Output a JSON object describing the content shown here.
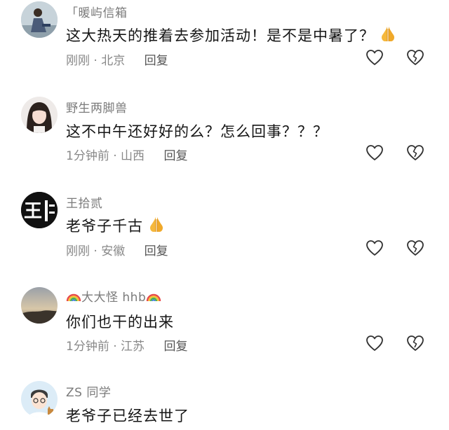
{
  "comments": [
    {
      "username": "「暖屿信箱",
      "text": "这大热天的推着去参加活动！是不是中暑了？",
      "time": "刚刚",
      "location": "北京",
      "reply_label": "回复",
      "has_pray_emoji": true
    },
    {
      "username": "野生两脚兽",
      "text": "这不中午还好好的么？怎么回事？？？",
      "time": "1分钟前",
      "location": "山西",
      "reply_label": "回复",
      "has_pray_emoji": false
    },
    {
      "username": "王拾贰",
      "text": "老爷子千古",
      "time": "刚刚",
      "location": "安徽",
      "reply_label": "回复",
      "has_pray_emoji": true,
      "avatar_text": "王"
    },
    {
      "username": "大大怪 hhb",
      "text": "你们也干的出来",
      "time": "1分钟前",
      "location": "江苏",
      "reply_label": "回复",
      "has_pray_emoji": false
    },
    {
      "username": "ZS 同学",
      "text": "老爷子已经去世了",
      "time": "",
      "location": "",
      "reply_label": "",
      "has_pray_emoji": false
    }
  ],
  "separator": "·",
  "icons": {
    "like": "heart-outline-icon",
    "dislike": "broken-heart-icon",
    "pray": "folded-hands-emoji",
    "rainbow": "rainbow-emoji"
  },
  "colors": {
    "username": "#7b7b7b",
    "text": "#161616",
    "meta": "#888888",
    "icon": "#333333"
  }
}
